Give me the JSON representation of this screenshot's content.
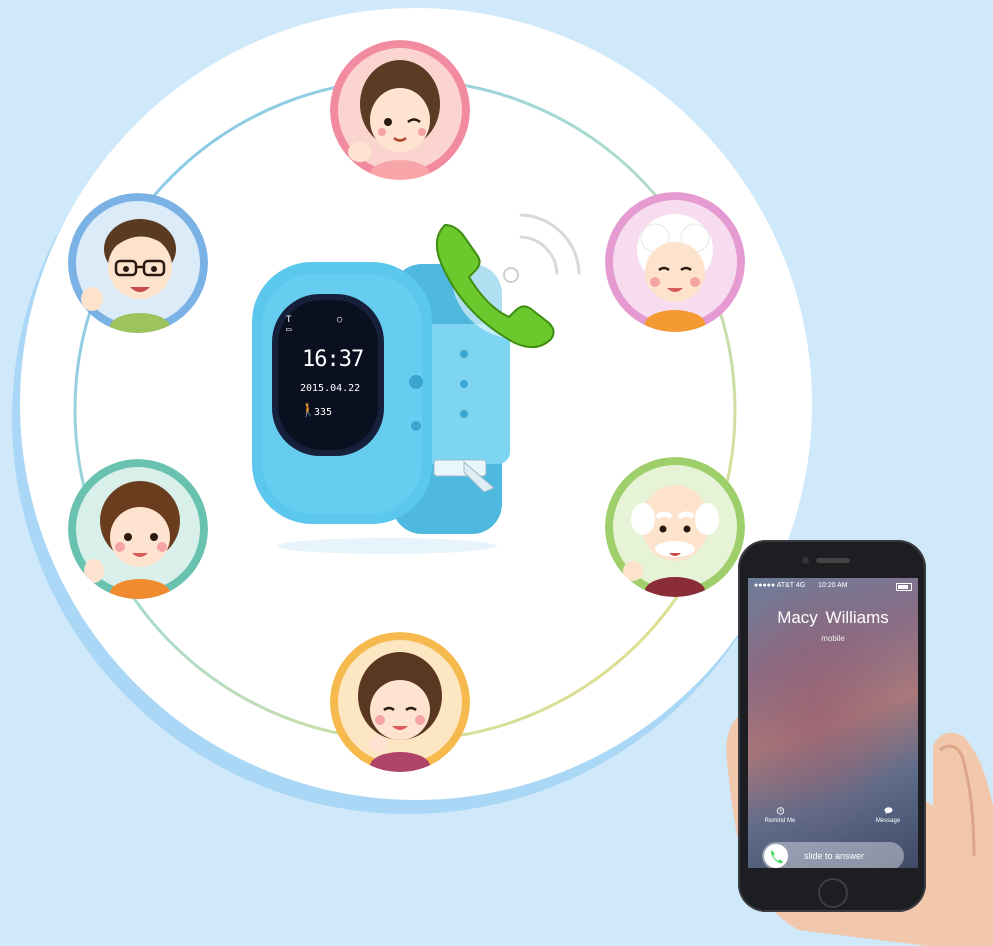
{
  "watch": {
    "time": "16:37",
    "date": "2015.04.22",
    "steps": "335"
  },
  "phone": {
    "carrier": "●●●●● AT&T  4G",
    "time": "10:20 AM",
    "caller_name": "Macy  Williams",
    "caller_type": "mobile",
    "remind_label": "Remind Me",
    "message_label": "Message",
    "slide_label": "slide to answer"
  },
  "colors": {
    "background": "#cfe9fb",
    "watch_band": "#5cc7ec",
    "call_icon": "#6cc92d"
  }
}
